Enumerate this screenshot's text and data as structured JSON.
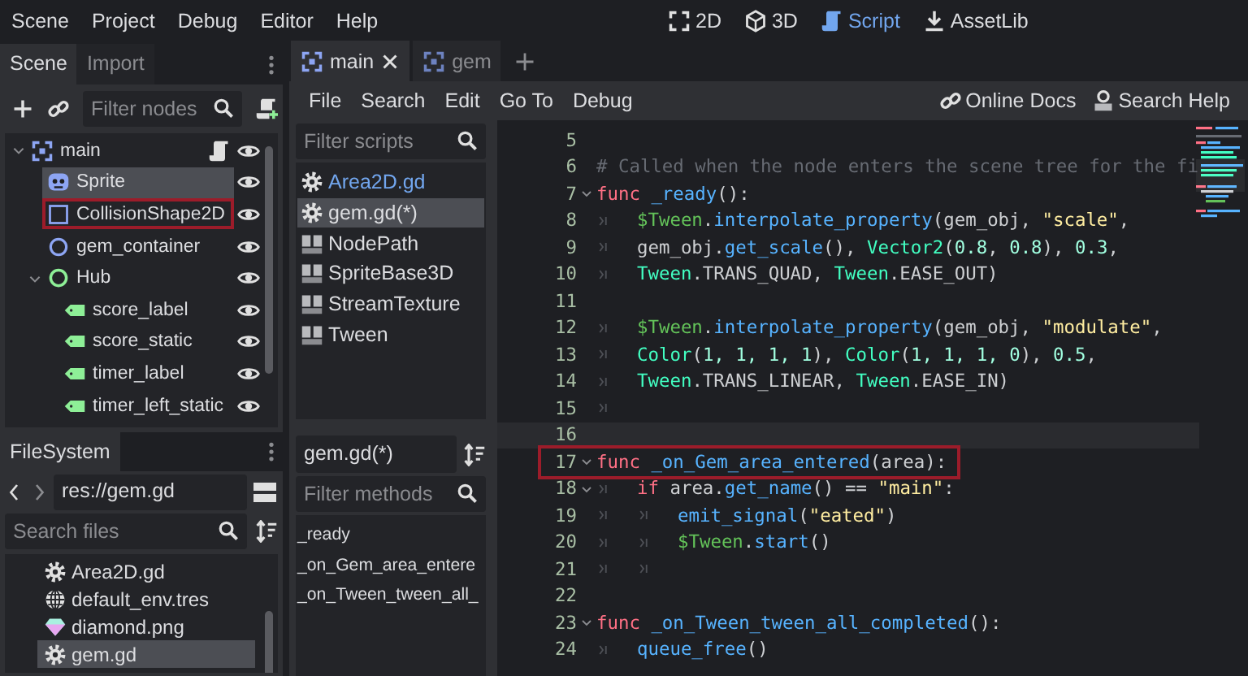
{
  "menu": [
    "Scene",
    "Project",
    "Debug",
    "Editor",
    "Help"
  ],
  "workspaces": [
    {
      "label": "2D",
      "kind": "flat",
      "selected": false
    },
    {
      "label": "3D",
      "kind": "spatial",
      "selected": false
    },
    {
      "label": "Script",
      "kind": "script",
      "selected": true
    },
    {
      "label": "AssetLib",
      "kind": "assetlib",
      "selected": false
    }
  ],
  "scene_dock": {
    "tabs": [
      {
        "label": "Scene",
        "selected": true
      },
      {
        "label": "Import",
        "selected": false
      }
    ],
    "filter": {
      "placeholder": "Filter nodes"
    },
    "tree": [
      {
        "name": "main",
        "kind": "node2d",
        "expanded": true,
        "script": true,
        "selected": false,
        "highlighted": false,
        "children": [
          {
            "name": "Sprite",
            "kind": "sprite",
            "script": false,
            "selected": true,
            "highlighted": false
          },
          {
            "name": "CollisionShape2D",
            "kind": "collision",
            "script": false,
            "selected": false,
            "highlighted": true
          },
          {
            "name": "gem_container",
            "kind": "node",
            "script": false,
            "selected": false,
            "highlighted": false
          },
          {
            "name": "Hub",
            "kind": "control",
            "expanded": true,
            "script": false,
            "selected": false,
            "highlighted": false,
            "children": [
              {
                "name": "score_label",
                "kind": "label",
                "script": false,
                "selected": false,
                "highlighted": false
              },
              {
                "name": "score_static",
                "kind": "label",
                "script": false,
                "selected": false,
                "highlighted": false
              },
              {
                "name": "timer_label",
                "kind": "label",
                "script": false,
                "selected": false,
                "highlighted": false
              },
              {
                "name": "timer_left_static",
                "kind": "label",
                "script": false,
                "selected": false,
                "highlighted": false
              }
            ]
          }
        ]
      }
    ]
  },
  "filesystem": {
    "tab": "FileSystem",
    "path": "res://gem.gd",
    "search": {
      "placeholder": "Search files"
    },
    "files": [
      {
        "name": "Area2D.gd",
        "kind": "script",
        "selected": false
      },
      {
        "name": "default_env.tres",
        "kind": "environment",
        "selected": false
      },
      {
        "name": "diamond.png",
        "kind": "image",
        "selected": false
      },
      {
        "name": "gem.gd",
        "kind": "script",
        "selected": true
      }
    ]
  },
  "editor": {
    "tabs": [
      {
        "label": "main",
        "selected": true
      },
      {
        "label": "gem",
        "selected": false
      }
    ],
    "menu": [
      "File",
      "Search",
      "Edit",
      "Go To",
      "Debug"
    ],
    "help_links": [
      {
        "label": "Online Docs",
        "kind": "link"
      },
      {
        "label": "Search Help",
        "kind": "doc"
      }
    ]
  },
  "scripts": {
    "filter": {
      "placeholder": "Filter scripts"
    },
    "items": [
      {
        "name": "Area2D.gd",
        "kind": "script",
        "selected": false,
        "color": "#72a6ee"
      },
      {
        "name": "gem.gd(*)",
        "kind": "script",
        "selected": true,
        "color": "#dcdde0"
      },
      {
        "name": "NodePath",
        "kind": "doc",
        "selected": false,
        "color": "#dcdde0"
      },
      {
        "name": "SpriteBase3D",
        "kind": "doc",
        "selected": false,
        "color": "#dcdde0"
      },
      {
        "name": "StreamTexture",
        "kind": "doc",
        "selected": false,
        "color": "#dcdde0"
      },
      {
        "name": "Tween",
        "kind": "doc",
        "selected": false,
        "color": "#dcdde0"
      }
    ]
  },
  "methods": {
    "title": "gem.gd(*)",
    "filter": {
      "placeholder": "Filter methods"
    },
    "items": [
      "_ready",
      "_on_Gem_area_entere",
      "_on_Tween_tween_all_"
    ]
  },
  "code": {
    "lines": [
      {
        "number": "5",
        "fold": false,
        "current": false,
        "highlighted": false
      },
      {
        "number": "6",
        "fold": false,
        "current": false,
        "highlighted": false,
        "tokens": [
          {
            "kind": "comment",
            "text": "# Called when the node enters the scene tree for the fi"
          }
        ]
      },
      {
        "number": "7",
        "fold": true,
        "current": false,
        "highlighted": false,
        "tokens": [
          {
            "kind": "keyword",
            "text": "func"
          },
          {
            "kind": "func",
            "text": "_ready"
          },
          {
            "kind": "plain",
            "text": "():"
          }
        ]
      },
      {
        "number": "8",
        "fold": false,
        "current": false,
        "highlighted": false,
        "tokens": [
          {
            "kind": "tab"
          },
          {
            "kind": "node",
            "text": "$Tween"
          },
          {
            "kind": "plain",
            "text": "."
          },
          {
            "kind": "func",
            "text": "interpolate_property"
          },
          {
            "kind": "plain",
            "text": "(gem_obj, "
          },
          {
            "kind": "string",
            "text": "\"scale\""
          },
          {
            "kind": "plain",
            "text": ","
          }
        ]
      },
      {
        "number": "9",
        "fold": false,
        "current": false,
        "highlighted": false,
        "tokens": [
          {
            "kind": "tab"
          },
          {
            "kind": "plain",
            "text": "gem_obj."
          },
          {
            "kind": "func",
            "text": "get_scale"
          },
          {
            "kind": "plain",
            "text": "(), "
          },
          {
            "kind": "type",
            "text": "Vector2"
          },
          {
            "kind": "plain",
            "text": "("
          },
          {
            "kind": "number",
            "text": "0.8"
          },
          {
            "kind": "plain",
            "text": ", "
          },
          {
            "kind": "number",
            "text": "0.8"
          },
          {
            "kind": "plain",
            "text": "), "
          },
          {
            "kind": "number",
            "text": "0.3"
          },
          {
            "kind": "plain",
            "text": ","
          }
        ]
      },
      {
        "number": "10",
        "fold": false,
        "current": false,
        "highlighted": false,
        "tokens": [
          {
            "kind": "tab"
          },
          {
            "kind": "type",
            "text": "Tween"
          },
          {
            "kind": "plain",
            "text": ".TRANS_QUAD, "
          },
          {
            "kind": "type",
            "text": "Tween"
          },
          {
            "kind": "plain",
            "text": ".EASE_OUT)"
          }
        ]
      },
      {
        "number": "11",
        "fold": false,
        "current": false,
        "highlighted": false
      },
      {
        "number": "12",
        "fold": false,
        "current": false,
        "highlighted": false,
        "tokens": [
          {
            "kind": "tab"
          },
          {
            "kind": "node",
            "text": "$Tween"
          },
          {
            "kind": "plain",
            "text": "."
          },
          {
            "kind": "func",
            "text": "interpolate_property"
          },
          {
            "kind": "plain",
            "text": "(gem_obj, "
          },
          {
            "kind": "string",
            "text": "\"modulate\""
          },
          {
            "kind": "plain",
            "text": ","
          }
        ]
      },
      {
        "number": "13",
        "fold": false,
        "current": false,
        "highlighted": false,
        "tokens": [
          {
            "kind": "tab"
          },
          {
            "kind": "type",
            "text": "Color"
          },
          {
            "kind": "plain",
            "text": "("
          },
          {
            "kind": "number",
            "text": "1, 1, 1, 1"
          },
          {
            "kind": "plain",
            "text": "), "
          },
          {
            "kind": "type",
            "text": "Color"
          },
          {
            "kind": "plain",
            "text": "("
          },
          {
            "kind": "number",
            "text": "1, 1, 1, 0"
          },
          {
            "kind": "plain",
            "text": "), "
          },
          {
            "kind": "number",
            "text": "0.5"
          },
          {
            "kind": "plain",
            "text": ","
          }
        ]
      },
      {
        "number": "14",
        "fold": false,
        "current": false,
        "highlighted": false,
        "tokens": [
          {
            "kind": "tab"
          },
          {
            "kind": "type",
            "text": "Tween"
          },
          {
            "kind": "plain",
            "text": ".TRANS_LINEAR, "
          },
          {
            "kind": "type",
            "text": "Tween"
          },
          {
            "kind": "plain",
            "text": ".EASE_IN)"
          }
        ]
      },
      {
        "number": "15",
        "fold": false,
        "current": false,
        "highlighted": false,
        "tokens": [
          {
            "kind": "tab"
          }
        ]
      },
      {
        "number": "16",
        "fold": false,
        "current": true,
        "highlighted": false
      },
      {
        "number": "17",
        "fold": true,
        "current": false,
        "highlighted": true,
        "tokens": [
          {
            "kind": "keyword",
            "text": "func"
          },
          {
            "kind": "func",
            "text": "_on_Gem_area_entered"
          },
          {
            "kind": "plain",
            "text": "(area):"
          }
        ]
      },
      {
        "number": "18",
        "fold": true,
        "current": false,
        "highlighted": false,
        "tokens": [
          {
            "kind": "tab"
          },
          {
            "kind": "keyword",
            "text": "if"
          },
          {
            "kind": "plain",
            "text": " area."
          },
          {
            "kind": "func",
            "text": "get_name"
          },
          {
            "kind": "plain",
            "text": "() == "
          },
          {
            "kind": "string",
            "text": "\"main\""
          },
          {
            "kind": "plain",
            "text": ":"
          }
        ]
      },
      {
        "number": "19",
        "fold": false,
        "current": false,
        "highlighted": false,
        "tokens": [
          {
            "kind": "tab"
          },
          {
            "kind": "tab"
          },
          {
            "kind": "func",
            "text": "emit_signal"
          },
          {
            "kind": "plain",
            "text": "("
          },
          {
            "kind": "string",
            "text": "\"eated\""
          },
          {
            "kind": "plain",
            "text": ")"
          }
        ]
      },
      {
        "number": "20",
        "fold": false,
        "current": false,
        "highlighted": false,
        "tokens": [
          {
            "kind": "tab"
          },
          {
            "kind": "tab"
          },
          {
            "kind": "node",
            "text": "$Tween"
          },
          {
            "kind": "plain",
            "text": "."
          },
          {
            "kind": "func",
            "text": "start"
          },
          {
            "kind": "plain",
            "text": "()"
          }
        ]
      },
      {
        "number": "21",
        "fold": false,
        "current": false,
        "highlighted": false,
        "tokens": [
          {
            "kind": "tab"
          },
          {
            "kind": "tab"
          }
        ]
      },
      {
        "number": "22",
        "fold": false,
        "current": false,
        "highlighted": false
      },
      {
        "number": "23",
        "fold": true,
        "current": false,
        "highlighted": false,
        "tokens": [
          {
            "kind": "keyword",
            "text": "func"
          },
          {
            "kind": "func",
            "text": "_on_Tween_tween_all_completed"
          },
          {
            "kind": "plain",
            "text": "():"
          }
        ]
      },
      {
        "number": "24",
        "fold": false,
        "current": false,
        "highlighted": false,
        "tokens": [
          {
            "kind": "tab"
          },
          {
            "kind": "func",
            "text": "queue_free"
          },
          {
            "kind": "plain",
            "text": "()"
          }
        ]
      }
    ]
  }
}
